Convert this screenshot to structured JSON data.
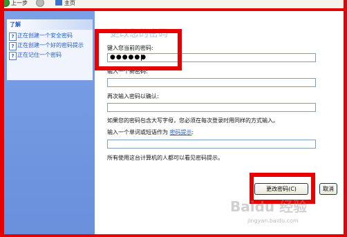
{
  "toolbar": {
    "back_label": "上一步",
    "home_label": "主页",
    "back_icon": "back-arrow-icon",
    "forward_icon": "forward-arrow-icon",
    "home_icon": "home-icon"
  },
  "sidebar": {
    "header": "了解",
    "items": [
      {
        "label": "正在创建一个安全密码",
        "icon": "help-icon"
      },
      {
        "label": "正在创建一个好的密码提示",
        "icon": "help-icon"
      },
      {
        "label": "正在记住一个密码",
        "icon": "help-icon"
      }
    ]
  },
  "main": {
    "title": "更改您的密码",
    "current_password_label": "键入您当前的密码:",
    "current_password_value": "●●●●●●",
    "new_password_label": "输入一个新密码:",
    "confirm_password_label": "再次输入密码以确认:",
    "case_note": "如果您的密码包含大写字母，您必须在每次登录时用同样的方式输入。",
    "hint_label_prefix": "输入一个单词或短语作为",
    "hint_link": "密码提示",
    "hint_label_suffix": ":",
    "hint_visibility_note": "所有使用这台计算机的人都可以看见密码提示。",
    "change_button": "更改密码(C)",
    "cancel_button": "取消"
  },
  "watermark": {
    "brand": "Baidu 经验",
    "url": "jingyan.baidu.com"
  },
  "colors": {
    "highlight": "#e60000",
    "pane_blue": "#6a8fdc",
    "link_blue": "#215dc6"
  }
}
